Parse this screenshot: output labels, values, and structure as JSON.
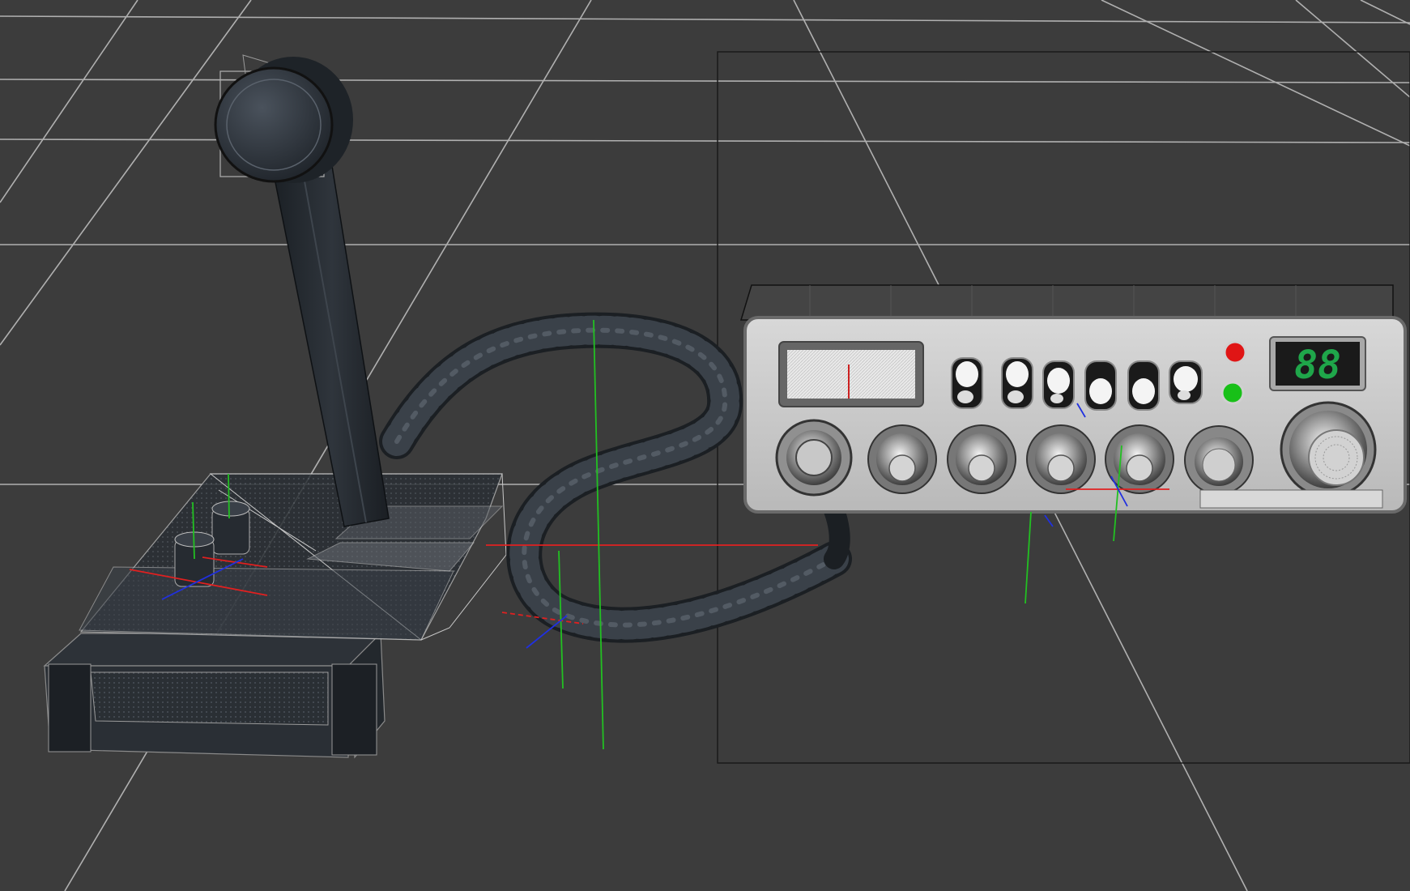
{
  "viewport": {
    "background": "#3c3c3c",
    "grid_color": "#bdbdbd",
    "axis_colors": {
      "x": "#e02020",
      "y": "#22c022",
      "z": "#2030e0"
    }
  },
  "radio": {
    "channel_display": "88",
    "display_color": "#1fa64a",
    "led_top_color": "#e01515",
    "led_bottom_color": "#18c018",
    "faceplate_color": "#c9c9c9"
  },
  "microphone": {
    "body_color": "#2b3036",
    "cord_color": "#262b30"
  }
}
